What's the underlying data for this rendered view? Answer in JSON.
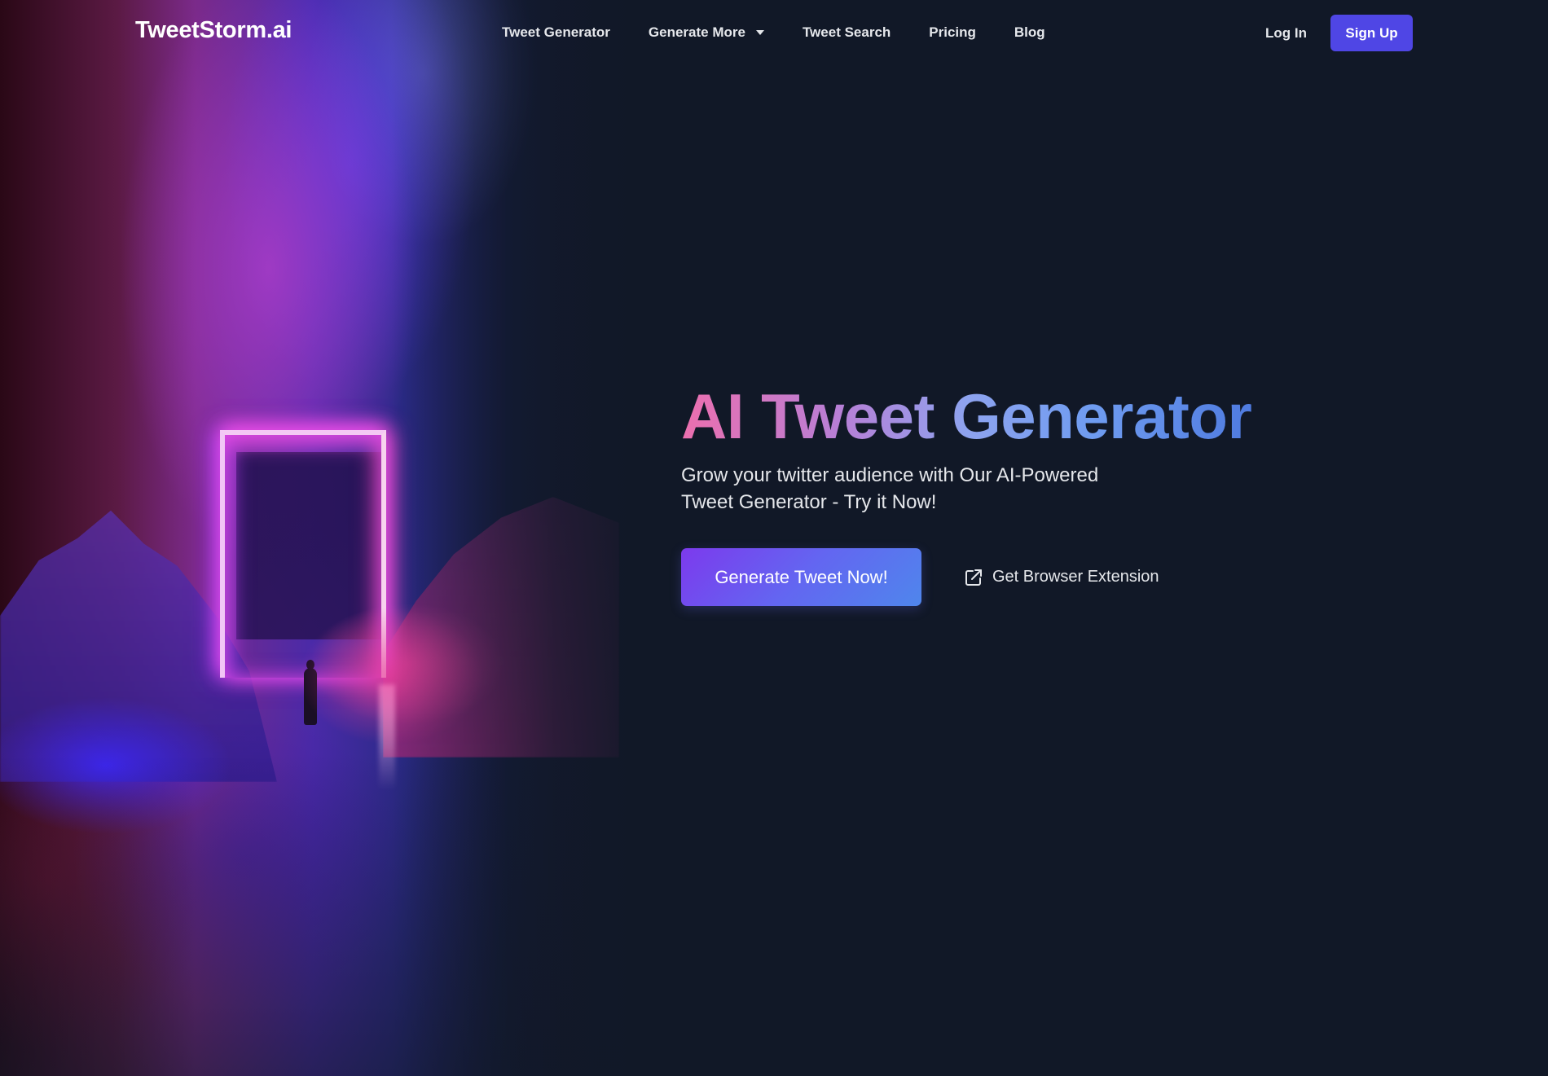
{
  "brand": {
    "name": "TweetStorm.ai"
  },
  "nav": {
    "links": [
      {
        "label": "Tweet Generator"
      },
      {
        "label": "Generate More",
        "has_dropdown": true
      },
      {
        "label": "Tweet Search"
      },
      {
        "label": "Pricing"
      },
      {
        "label": "Blog"
      }
    ],
    "login_label": "Log In",
    "signup_label": "Sign Up"
  },
  "hero": {
    "title": "AI Tweet Generator",
    "subtitle": "Grow your twitter audience with Our AI-Powered Tweet Generator - Try it Now!",
    "primary_cta": "Generate Tweet Now!",
    "secondary_cta": "Get Browser Extension",
    "secondary_icon": "external-link-icon",
    "image_description": "neon portal doorway with lone figure in misty landscape"
  },
  "colors": {
    "background": "#111827",
    "accent": "#4f46e5",
    "title_gradient_start": "#ec6fae",
    "title_gradient_end": "#4f7be0",
    "cta_gradient_start": "#7c3aed",
    "cta_gradient_end": "#4f86ec"
  }
}
